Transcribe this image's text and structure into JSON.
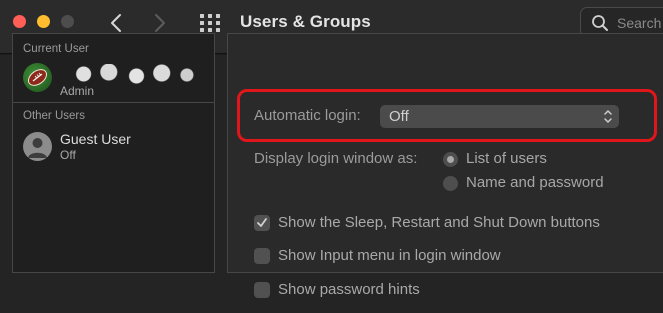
{
  "window": {
    "title": "Users & Groups",
    "search_placeholder": "Search"
  },
  "users": {
    "current_header": "Current User",
    "current_user": {
      "name": "",
      "role": "Admin"
    },
    "other_header": "Other Users",
    "guest": {
      "name": "Guest User",
      "status": "Off"
    }
  },
  "settings": {
    "automatic_login_label": "Automatic login:",
    "automatic_login_value": "Off",
    "display_login_label": "Display login window as:",
    "radio_options": [
      {
        "label": "List of users",
        "selected": true
      },
      {
        "label": "Name and password",
        "selected": false
      }
    ],
    "checkboxes": [
      {
        "label": "Show the Sleep, Restart and Shut Down buttons",
        "checked": true
      },
      {
        "label": "Show Input menu in login window",
        "checked": false
      },
      {
        "label": "Show password hints",
        "checked": false
      }
    ]
  },
  "colors": {
    "highlight": "#e0161b",
    "close": "#ff5f57",
    "minimize": "#febc2e"
  }
}
